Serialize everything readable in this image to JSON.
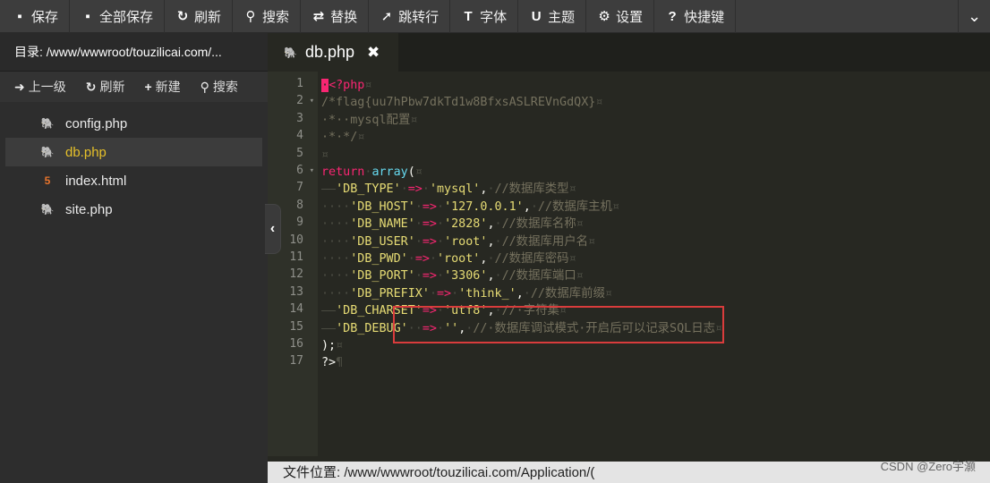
{
  "toolbar": {
    "buttons": [
      {
        "label": "保存",
        "icon": "save-icon",
        "glyph": "▪"
      },
      {
        "label": "全部保存",
        "icon": "save-all-icon",
        "glyph": "▪"
      },
      {
        "label": "刷新",
        "icon": "refresh-icon",
        "glyph": "↻"
      },
      {
        "label": "搜索",
        "icon": "search-icon",
        "glyph": "⚲"
      },
      {
        "label": "替换",
        "icon": "replace-icon",
        "glyph": "⇄"
      },
      {
        "label": "跳转行",
        "icon": "goto-line-icon",
        "glyph": "➚"
      },
      {
        "label": "字体",
        "icon": "font-icon",
        "glyph": "T"
      },
      {
        "label": "主题",
        "icon": "theme-icon",
        "glyph": "U"
      },
      {
        "label": "设置",
        "icon": "gear-icon",
        "glyph": "⚙"
      },
      {
        "label": "快捷键",
        "icon": "help-icon",
        "glyph": "?"
      }
    ],
    "collapse_glyph": "⌄"
  },
  "sidebar": {
    "dir_label": "目录: /www/wwwroot/touzilicai.com/...",
    "actions": [
      {
        "label": "上一级",
        "icon": "up-arrow-icon",
        "glyph": "➜"
      },
      {
        "label": "刷新",
        "icon": "refresh-icon",
        "glyph": "↻"
      },
      {
        "label": "新建",
        "icon": "plus-icon",
        "glyph": "+"
      },
      {
        "label": "搜索",
        "icon": "search-icon",
        "glyph": "⚲"
      }
    ],
    "files": [
      {
        "name": "config.php",
        "type": "php",
        "active": false
      },
      {
        "name": "db.php",
        "type": "php",
        "active": true
      },
      {
        "name": "index.html",
        "type": "html",
        "active": false
      },
      {
        "name": "site.php",
        "type": "php",
        "active": false
      }
    ],
    "toggle_glyph": "‹"
  },
  "editor": {
    "tab": {
      "name": "db.php",
      "close_glyph": "✖"
    },
    "lines": [
      {
        "n": "1",
        "fold": false,
        "tokens": [
          [
            "cursor",
            "·"
          ],
          [
            "key",
            "<?php"
          ],
          [
            "ws",
            "¤"
          ]
        ]
      },
      {
        "n": "2",
        "fold": true,
        "tokens": [
          [
            "comment",
            "/*flag{uu7hPbw7dkTd1w8BfxsASLREVnGdQX}"
          ],
          [
            "ws",
            "¤"
          ]
        ]
      },
      {
        "n": "3",
        "fold": false,
        "tokens": [
          [
            "comment",
            "·*··mysql配置"
          ],
          [
            "ws",
            "¤"
          ]
        ]
      },
      {
        "n": "4",
        "fold": false,
        "tokens": [
          [
            "comment",
            "·*·*/"
          ],
          [
            "ws",
            "¤"
          ]
        ]
      },
      {
        "n": "5",
        "fold": false,
        "tokens": [
          [
            "ws",
            "¤"
          ]
        ]
      },
      {
        "n": "6",
        "fold": true,
        "tokens": [
          [
            "key",
            "return"
          ],
          [
            "ws",
            "·"
          ],
          [
            "fn",
            "array"
          ],
          [
            "plain",
            "("
          ],
          [
            "ws",
            "¤"
          ]
        ]
      },
      {
        "n": "7",
        "fold": false,
        "tokens": [
          [
            "ws",
            "——"
          ],
          [
            "str",
            "'DB_TYPE'"
          ],
          [
            "ws",
            "·"
          ],
          [
            "key",
            "=>"
          ],
          [
            "ws",
            "·"
          ],
          [
            "str",
            "'mysql'"
          ],
          [
            "plain",
            ","
          ],
          [
            "ws",
            "·"
          ],
          [
            "comment",
            "//数据库类型"
          ],
          [
            "ws",
            "¤"
          ]
        ]
      },
      {
        "n": "8",
        "fold": false,
        "tokens": [
          [
            "ws",
            "····"
          ],
          [
            "str",
            "'DB_HOST'"
          ],
          [
            "ws",
            "·"
          ],
          [
            "key",
            "=>"
          ],
          [
            "ws",
            "·"
          ],
          [
            "str",
            "'127.0.0.1'"
          ],
          [
            "plain",
            ","
          ],
          [
            "ws",
            "·"
          ],
          [
            "comment",
            "//数据库主机"
          ],
          [
            "ws",
            "¤"
          ]
        ]
      },
      {
        "n": "9",
        "fold": false,
        "tokens": [
          [
            "ws",
            "····"
          ],
          [
            "str",
            "'DB_NAME'"
          ],
          [
            "ws",
            "·"
          ],
          [
            "key",
            "=>"
          ],
          [
            "ws",
            "·"
          ],
          [
            "str",
            "'2828'"
          ],
          [
            "plain",
            ","
          ],
          [
            "ws",
            "·"
          ],
          [
            "comment",
            "//数据库名称"
          ],
          [
            "ws",
            "¤"
          ]
        ]
      },
      {
        "n": "10",
        "fold": false,
        "tokens": [
          [
            "ws",
            "····"
          ],
          [
            "str",
            "'DB_USER'"
          ],
          [
            "ws",
            "·"
          ],
          [
            "key",
            "=>"
          ],
          [
            "ws",
            "·"
          ],
          [
            "str",
            "'root'"
          ],
          [
            "plain",
            ","
          ],
          [
            "ws",
            "·"
          ],
          [
            "comment",
            "//数据库用户名"
          ],
          [
            "ws",
            "¤"
          ]
        ]
      },
      {
        "n": "11",
        "fold": false,
        "tokens": [
          [
            "ws",
            "····"
          ],
          [
            "str",
            "'DB_PWD'"
          ],
          [
            "ws",
            "·"
          ],
          [
            "key",
            "=>"
          ],
          [
            "ws",
            "·"
          ],
          [
            "str",
            "'root'"
          ],
          [
            "plain",
            ","
          ],
          [
            "ws",
            "·"
          ],
          [
            "comment",
            "//数据库密码"
          ],
          [
            "ws",
            "¤"
          ]
        ]
      },
      {
        "n": "12",
        "fold": false,
        "tokens": [
          [
            "ws",
            "····"
          ],
          [
            "str",
            "'DB_PORT'"
          ],
          [
            "ws",
            "·"
          ],
          [
            "key",
            "=>"
          ],
          [
            "ws",
            "·"
          ],
          [
            "str",
            "'3306'"
          ],
          [
            "plain",
            ","
          ],
          [
            "ws",
            "·"
          ],
          [
            "comment",
            "//数据库端口"
          ],
          [
            "ws",
            "¤"
          ]
        ]
      },
      {
        "n": "13",
        "fold": false,
        "tokens": [
          [
            "ws",
            "····"
          ],
          [
            "str",
            "'DB_PREFIX'"
          ],
          [
            "ws",
            "·"
          ],
          [
            "key",
            "=>"
          ],
          [
            "ws",
            "·"
          ],
          [
            "str",
            "'think_'"
          ],
          [
            "plain",
            ","
          ],
          [
            "ws",
            "·"
          ],
          [
            "comment",
            "//数据库前缀"
          ],
          [
            "ws",
            "¤"
          ]
        ]
      },
      {
        "n": "14",
        "fold": false,
        "tokens": [
          [
            "ws",
            "——"
          ],
          [
            "str",
            "'DB_CHARSET'"
          ],
          [
            "key",
            "=>"
          ],
          [
            "ws",
            "·"
          ],
          [
            "str",
            "'utf8'"
          ],
          [
            "plain",
            ","
          ],
          [
            "ws",
            "·"
          ],
          [
            "comment",
            "//·字符集"
          ],
          [
            "ws",
            "¤"
          ]
        ]
      },
      {
        "n": "15",
        "fold": false,
        "tokens": [
          [
            "ws",
            "——"
          ],
          [
            "str",
            "'DB_DEBUG'"
          ],
          [
            "ws",
            "··"
          ],
          [
            "key",
            "=>"
          ],
          [
            "ws",
            "·"
          ],
          [
            "str",
            "''"
          ],
          [
            "plain",
            ","
          ],
          [
            "ws",
            "·"
          ],
          [
            "comment",
            "//·数据库调试模式·开启后可以记录SQL日志"
          ],
          [
            "ws",
            "¤"
          ]
        ]
      },
      {
        "n": "16",
        "fold": false,
        "tokens": [
          [
            "plain",
            ");"
          ],
          [
            "ws",
            "¤"
          ]
        ]
      },
      {
        "n": "17",
        "fold": false,
        "tokens": [
          [
            "plain",
            "?>"
          ],
          [
            "ws",
            "¶"
          ]
        ]
      }
    ]
  },
  "statusbar": {
    "file_location": "文件位置: /www/wwwroot/touzilicai.com/Application/("
  },
  "watermark": "CSDN @Zero宇灏",
  "colors": {
    "keyword": "#f92672",
    "function": "#66d9ef",
    "string": "#e6db74",
    "comment": "#75715e",
    "highlight_box": "#d93c3c",
    "active_file": "#e6c02a"
  }
}
